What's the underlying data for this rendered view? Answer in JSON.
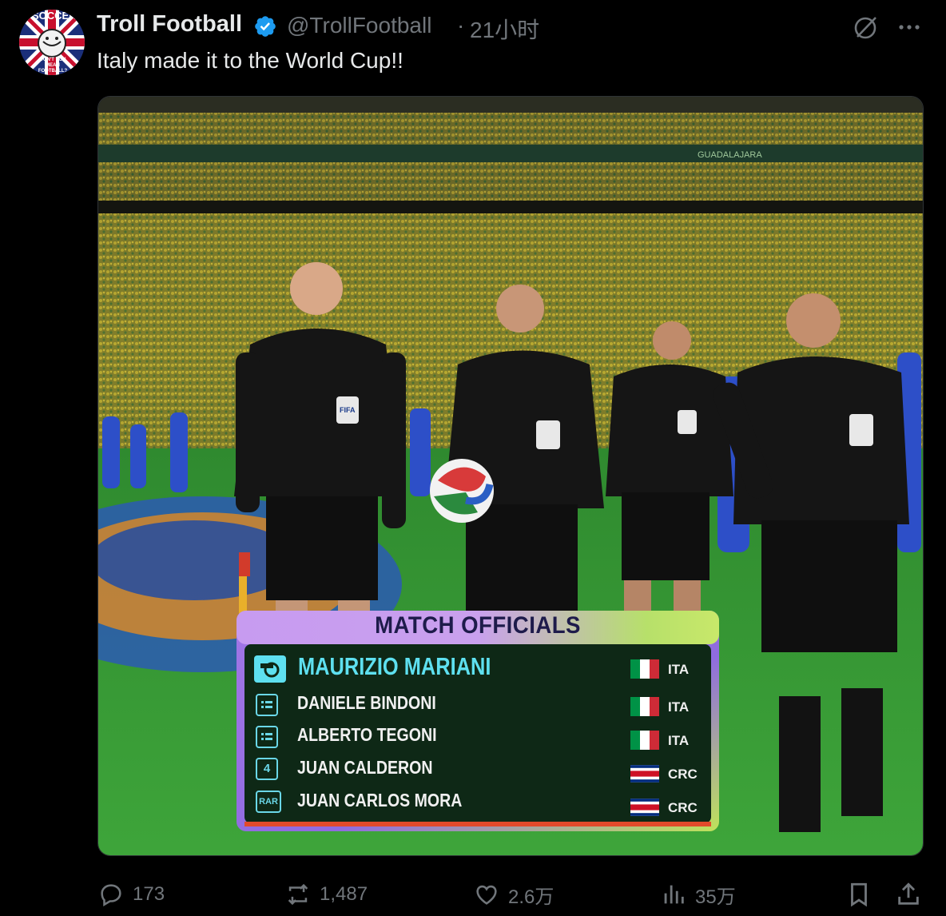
{
  "tweet": {
    "author_name": "Troll Football",
    "handle": "@TrollFootball",
    "separator": "·",
    "time": "21小时",
    "text": "Italy made it to the World Cup!!",
    "avatar": {
      "top_text": "SOCCER",
      "bottom_text": "DON'T YOU MEAN FOOTBALL?"
    }
  },
  "media": {
    "stadium_banner": "GUADALAJARA",
    "badge_text": "FIFA",
    "overlay": {
      "title": "MATCH OFFICIALS",
      "officials": [
        {
          "name": "MAURIZIO MARIANI",
          "country": "ITA",
          "role_icon": "whistle-icon",
          "flag": "italy"
        },
        {
          "name": "DANIELE BINDONI",
          "country": "ITA",
          "role_icon": "flag-card-icon",
          "flag": "italy"
        },
        {
          "name": "ALBERTO TEGONI",
          "country": "ITA",
          "role_icon": "flag-card-icon",
          "flag": "italy"
        },
        {
          "name": "JUAN CALDERON",
          "country": "CRC",
          "role_label": "4",
          "flag": "costa-rica"
        },
        {
          "name": "JUAN CARLOS MORA",
          "country": "CRC",
          "role_label": "RAR",
          "flag": "costa-rica"
        }
      ]
    }
  },
  "actions": {
    "replies": "173",
    "reposts": "1,487",
    "likes": "2.6万",
    "views": "35万"
  },
  "colors": {
    "background": "#000000",
    "text": "#e7e9ea",
    "muted": "#71767b",
    "verified": "#1d9bf0",
    "overlay_accent": "#5ee0f0"
  }
}
